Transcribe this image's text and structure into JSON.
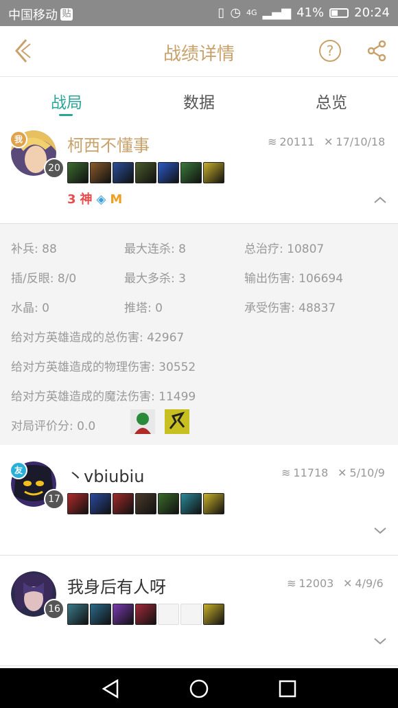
{
  "status_bar": {
    "carrier": "中国移动",
    "carrier_badge": "贴",
    "network": "4G",
    "battery": "41%",
    "battery_level": 0.41,
    "time": "20:24"
  },
  "header": {
    "title": "战绩详情",
    "help_label": "?"
  },
  "tabs": [
    {
      "label": "战局",
      "active": true
    },
    {
      "label": "数据",
      "active": false
    },
    {
      "label": "总览",
      "active": false
    }
  ],
  "players": [
    {
      "name": "柯西不懂事",
      "tag": "我",
      "tag_color": "#e0a24a",
      "level": "20",
      "gold": "20111",
      "kda": "17/10/18",
      "items": [
        "#3b6b2e",
        "#8a5a2a",
        "#2a4f9a",
        "#4a5a2a",
        "#2a5ac8",
        "#3a7a3a",
        "#c8b02a"
      ],
      "badges": [
        {
          "text": "3",
          "color": "#e84c4c"
        },
        {
          "text": "神",
          "color": "#e84c4c"
        },
        {
          "text": "◈",
          "color": "#3aa0e0"
        },
        {
          "text": "M",
          "color": "#f0a020"
        }
      ],
      "expanded": true
    },
    {
      "name": "丶vbiubiu",
      "tag": "友",
      "tag_color": "#2ab0d8",
      "level": "17",
      "gold": "11718",
      "kda": "5/10/9",
      "items": [
        "#b02a2a",
        "#2a4aa0",
        "#a02a2a",
        "#4a3a2a",
        "#3a6a2a",
        "#2a8a9a",
        "#c8b02a"
      ],
      "expanded": false
    },
    {
      "name": "我身后有人呀",
      "tag": "",
      "tag_color": "",
      "level": "16",
      "gold": "12003",
      "kda": "4/9/6",
      "items": [
        "#3a7a8a",
        "#2a6a8a",
        "#7a3ab0",
        "#a02a3a",
        "empty",
        "empty",
        "#c8b02a"
      ],
      "expanded": false
    }
  ],
  "stats": [
    {
      "label": "补兵:",
      "value": "88"
    },
    {
      "label": "最大连杀:",
      "value": "8"
    },
    {
      "label": "总治疗:",
      "value": "10807"
    },
    {
      "label": "插/反眼:",
      "value": "8/0"
    },
    {
      "label": "最大多杀:",
      "value": "3"
    },
    {
      "label": "输出伤害:",
      "value": "106694"
    },
    {
      "label": "水晶:",
      "value": "0"
    },
    {
      "label": "推塔:",
      "value": "0"
    },
    {
      "label": "承受伤害:",
      "value": "48837"
    },
    {
      "label": "给对方英雄造成的总伤害:",
      "value": "42967"
    },
    {
      "label": "给对方英雄造成的物理伤害:",
      "value": "30552"
    },
    {
      "label": "给对方英雄造成的魔法伤害:",
      "value": "11499"
    },
    {
      "label": "对局评价分:",
      "value": "0.0"
    }
  ],
  "colors": {
    "accent": "#c8a16b",
    "tab_active": "#2aa59a"
  }
}
